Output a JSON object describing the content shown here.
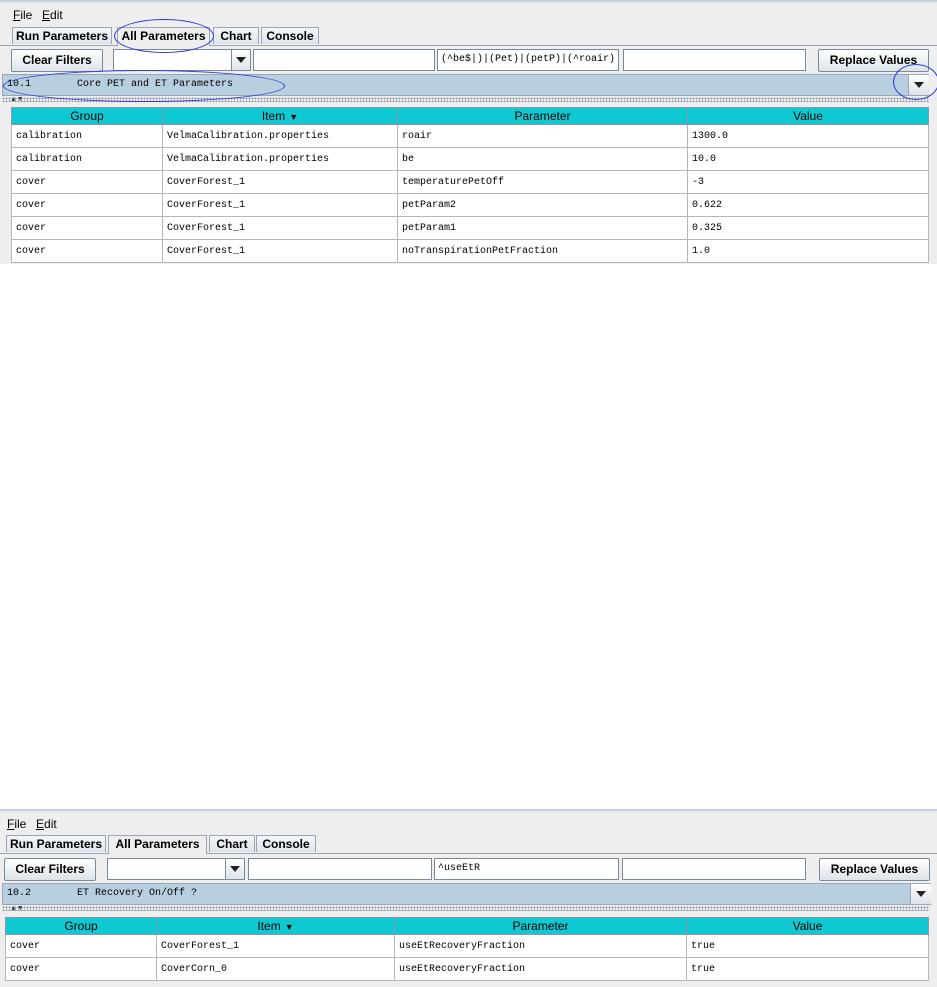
{
  "menu": {
    "file": "File",
    "edit": "Edit"
  },
  "tabs": [
    "Run Parameters",
    "All Parameters",
    "Chart",
    "Console"
  ],
  "toolbar": {
    "clear_filters": "Clear Filters",
    "replace_values": "Replace Values"
  },
  "columns": {
    "group": "Group",
    "item": "Item",
    "parameter": "Parameter",
    "value": "Value"
  },
  "icons": {
    "item_sort": "sort-descending-icon",
    "dropdown": "chevron-down-icon"
  },
  "colors": {
    "header": "#0ec9d2",
    "section_bar": "#b8cfe0",
    "annotation": "#2a3cdd"
  },
  "panel1": {
    "filter_value": "(^be$|)|(Pet)|(petP)|(^roair)",
    "section_number": "10.1",
    "section_title": "Core PET and ET Parameters",
    "rows": [
      [
        "calibration",
        "VelmaCalibration.properties",
        "roair",
        "1300.0"
      ],
      [
        "calibration",
        "VelmaCalibration.properties",
        "be",
        "10.0"
      ],
      [
        "cover",
        "CoverForest_1",
        "temperaturePetOff",
        "-3"
      ],
      [
        "cover",
        "CoverForest_1",
        "petParam2",
        "0.622"
      ],
      [
        "cover",
        "CoverForest_1",
        "petParam1",
        "0.325"
      ],
      [
        "cover",
        "CoverForest_1",
        "noTranspirationPetFraction",
        "1.0"
      ]
    ]
  },
  "panel2": {
    "filter_value": "^useEtR",
    "section_number": "10.2",
    "section_title": "ET Recovery On/Off ?",
    "rows": [
      [
        "cover",
        "CoverForest_1",
        "useEtRecoveryFraction",
        "true"
      ],
      [
        "cover",
        "CoverCorn_0",
        "useEtRecoveryFraction",
        "true"
      ]
    ]
  }
}
